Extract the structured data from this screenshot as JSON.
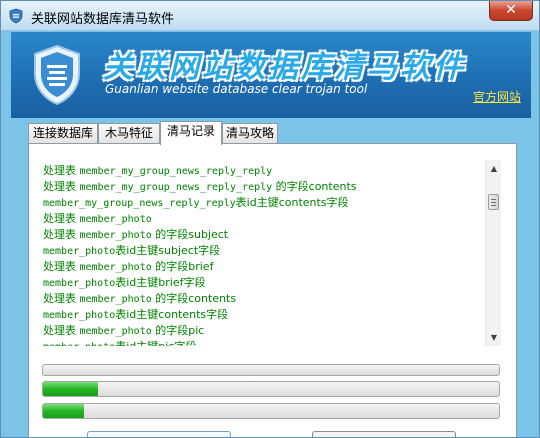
{
  "window": {
    "title": "关联网站数据库清马软件",
    "close_label": "✕"
  },
  "banner": {
    "title": "关联网站数据库清马软件",
    "subtitle": "Guanlian website  database clear  trojan tool",
    "official_link": "官方网站"
  },
  "tabs": [
    {
      "label": "连接数据库",
      "active": false
    },
    {
      "label": "木马特征",
      "active": false
    },
    {
      "label": "清马记录",
      "active": true
    },
    {
      "label": "清马攻略",
      "active": false
    }
  ],
  "log": {
    "lines": [
      {
        "cn": "处理表 ",
        "mono": "member_my_group_news_reply_reply",
        "tail": ""
      },
      {
        "cn": "处理表 ",
        "mono": "member_my_group_news_reply_reply",
        "tail": " 的字段contents"
      },
      {
        "cn": "",
        "mono": "member_my_group_news_reply_reply",
        "tail": "表id主键contents字段"
      },
      {
        "cn": "处理表 ",
        "mono": "member_photo",
        "tail": ""
      },
      {
        "cn": "处理表 ",
        "mono": "member_photo",
        "tail": " 的字段subject"
      },
      {
        "cn": "",
        "mono": "member_photo",
        "tail": "表id主键subject字段"
      },
      {
        "cn": "处理表 ",
        "mono": "member_photo",
        "tail": " 的字段brief"
      },
      {
        "cn": "",
        "mono": "member_photo",
        "tail": "表id主键brief字段"
      },
      {
        "cn": "处理表 ",
        "mono": "member_photo",
        "tail": " 的字段contents"
      },
      {
        "cn": "",
        "mono": "member_photo",
        "tail": "表id主键contents字段"
      },
      {
        "cn": "处理表 ",
        "mono": "member_photo",
        "tail": " 的字段pic"
      },
      {
        "cn": "",
        "mono": "member_photo",
        "tail": "表id主键pic字段"
      }
    ]
  },
  "progress": {
    "bar1": 0.0,
    "bar2": 0.12,
    "bar3": 0.09
  },
  "colors": {
    "log_text": "#008000",
    "banner_bg": "#1e6fb3",
    "link": "#ffe93a",
    "progress_fill": "#25b525"
  }
}
